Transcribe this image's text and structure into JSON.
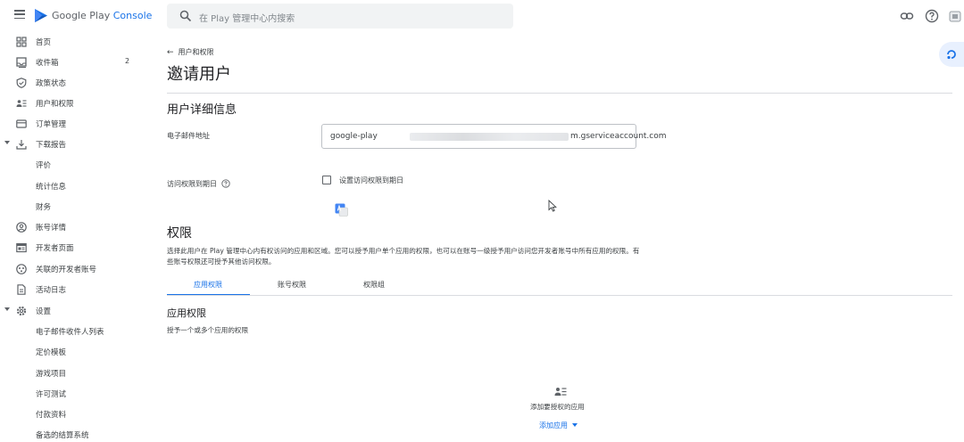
{
  "topbar": {
    "brand_prefix": "Google Play",
    "brand_accent": "Console",
    "search_placeholder": "在 Play 管理中心内搜索"
  },
  "sidebar": {
    "items": [
      {
        "label": "首页",
        "icon": "home-icon"
      },
      {
        "label": "收件箱",
        "icon": "inbox-icon",
        "badge": "2"
      },
      {
        "label": "政策状态",
        "icon": "shield-icon"
      },
      {
        "label": "用户和权限",
        "icon": "users-icon"
      },
      {
        "label": "订单管理",
        "icon": "card-icon"
      },
      {
        "label": "下载报告",
        "icon": "download-icon",
        "expanded": true
      },
      {
        "label": "评价"
      },
      {
        "label": "统计信息"
      },
      {
        "label": "财务"
      },
      {
        "label": "账号详情",
        "icon": "account-icon"
      },
      {
        "label": "开发者页面",
        "icon": "developer-page-icon"
      },
      {
        "label": "关联的开发者账号",
        "icon": "linked-accounts-icon"
      },
      {
        "label": "活动日志",
        "icon": "log-icon"
      },
      {
        "label": "设置",
        "icon": "gear-icon",
        "expanded": true
      },
      {
        "label": "电子邮件收件人列表"
      },
      {
        "label": "定价模板"
      },
      {
        "label": "游戏项目"
      },
      {
        "label": "许可测试"
      },
      {
        "label": "付款资料"
      },
      {
        "label": "备选的结算系统"
      }
    ]
  },
  "main": {
    "back_label": "用户和权限",
    "page_title": "邀请用户",
    "details_title": "用户详细信息",
    "email_label": "电子邮件地址",
    "email_value_start": "google-play",
    "email_value_end": "m.gserviceaccount.com",
    "expiry_label": "访问权限到期日",
    "expiry_checkbox_label": "设置访问权限到期日",
    "permissions_title": "权限",
    "permissions_desc": "选择此用户在 Play 管理中心内有权访问的应用和区域。您可以授予用户单个应用的权限，也可以在账号一级授予用户访问您开发者账号中所有应用的权限。有些账号权限还可授予其他访问权限。",
    "tabs": [
      {
        "label": "应用权限",
        "active": true
      },
      {
        "label": "账号权限",
        "active": false
      },
      {
        "label": "权限组",
        "active": false
      }
    ],
    "app_perm_title": "应用权限",
    "app_perm_desc": "授予一个或多个应用的权限",
    "empty_text": "添加要授权的应用",
    "add_app_label": "添加应用"
  },
  "colors": {
    "accent": "#1a73e8",
    "text": "#202124",
    "muted": "#5f6368",
    "border": "#dadce0"
  }
}
